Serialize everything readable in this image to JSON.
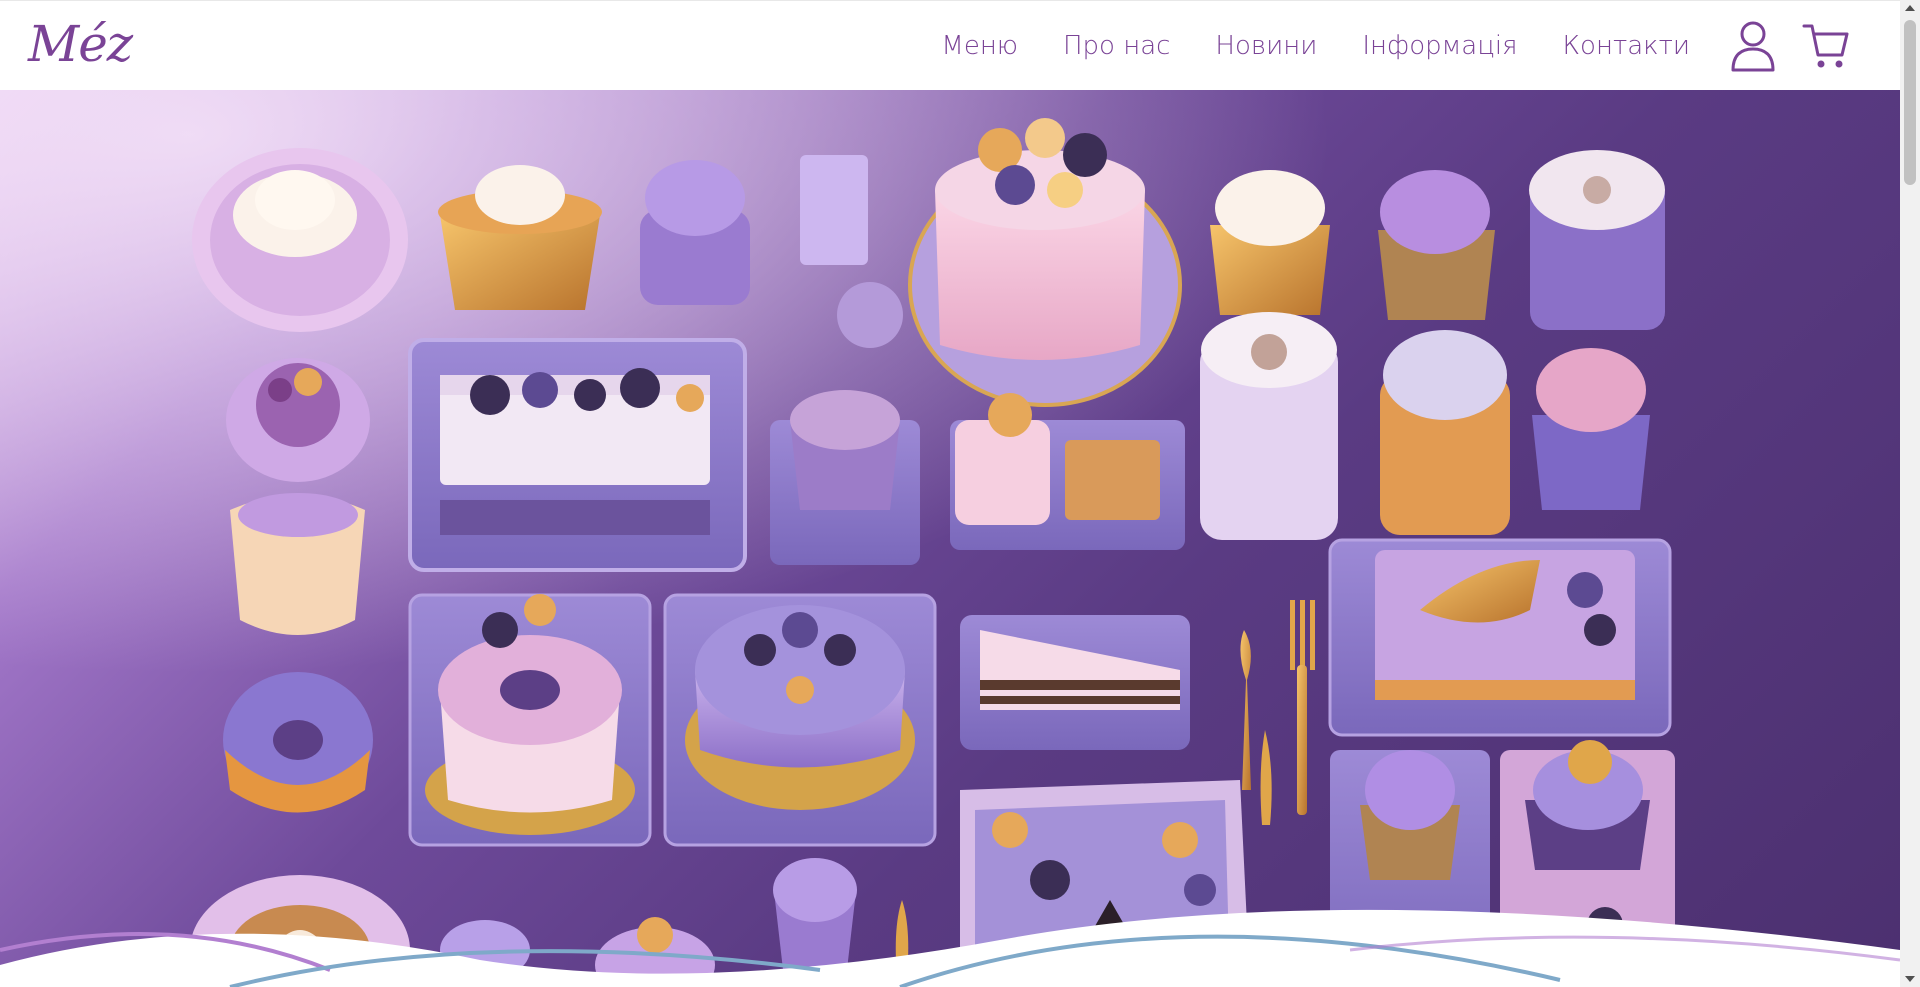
{
  "header": {
    "logo": "Méz",
    "nav": [
      {
        "label": "Меню"
      },
      {
        "label": "Про нас"
      },
      {
        "label": "Новини"
      },
      {
        "label": "Інформація"
      },
      {
        "label": "Контакти"
      }
    ],
    "icons": {
      "account": "user-icon",
      "cart": "cart-icon"
    }
  },
  "hero": {
    "image": "purple-desserts-flatlay"
  },
  "colors": {
    "brand": "#7a4396",
    "background_light": "#e7c8f0",
    "background_dark": "#4c3070",
    "accent_gold": "#e0a64a",
    "wave_blue": "#7fa9c9"
  }
}
